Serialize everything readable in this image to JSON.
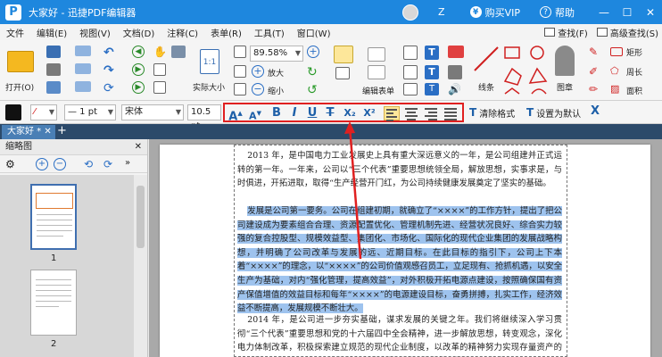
{
  "titlebar": {
    "logo": "P",
    "title": "大家好 - 迅捷PDF编辑器",
    "username": "Z",
    "buy_vip": "购买VIP",
    "help": "帮助",
    "minimize": "—",
    "maximize": "☐",
    "close": "✕"
  },
  "menu": {
    "items": [
      "文件",
      "编辑(E)",
      "视图(V)",
      "文档(D)",
      "注释(C)",
      "表单(R)",
      "工具(T)",
      "窗口(W)"
    ],
    "find": "查找(F)",
    "advanced_find": "高级查找(S)"
  },
  "ribbon": {
    "open": "打开(O)",
    "zoom_value": "89.58%",
    "zoom_in": "放大",
    "zoom_out": "缩小",
    "actual_size": "实际大小",
    "edit_form": "编辑表单",
    "line": "线条",
    "stamp": "图章",
    "rectangle": "矩形",
    "perimeter": "周长",
    "area": "面积"
  },
  "formatbar": {
    "line_width": "— 1 pt",
    "font_name": "宋体",
    "font_size": "10.5 pt",
    "grow": "A",
    "shrink": "A",
    "bold": "B",
    "italic": "I",
    "underline": "U",
    "strike": "T",
    "subscript": "X₂",
    "superscript": "X²",
    "clear_format": "清除格式",
    "set_default": "设置为默认"
  },
  "tabs": {
    "doc_tab": "大家好 *",
    "add": "+"
  },
  "sidebar": {
    "title": "缩略图",
    "close": "✕",
    "page_numbers": [
      "1",
      "2"
    ]
  },
  "document": {
    "para1": "2013 年，是中国电力工业发展史上具有重大深远意义的一年，是公司组建并正式运转的第一年。一年来，公司以“三个代表”重要思想统领全局，解放思想，实事求是，与时俱进，开拓进取，取得“生产经营开门红，为公司持续健康发展奠定了坚实的基础。",
    "para2": "发展是公司第一要务。公司在组建初期，就确立了“××××”的工作方针，提出了把公司建设成为要素组合合理、资源配置优化、管理机制先进、经营状况良好、综合实力较强的复合控股型、规模效益型、集团化、市场化、国际化的现代企业集团的发展战略构想，并明确了公司改革与发展的远、近期目标。在此目标的指引下，公司上下本着“××××”的理念，以“××××”的公司价值观感召员工，立足现有、抢抓机遇，以安全生产为基础，对内“强化管理，提高效益”，对外积极开拓电源点建设，按照确保国有资产保值增值的效益目标和每年“××××”的电源建设目标，奋勇拼搏，扎实工作，经济效益不断提高，发展规模不断壮大。",
    "para3": "2014 年，是公司进一步夯实基础，谋求发展的关键之年。我们将继续深入学习贯彻“三个代表”重要思想和党的十六届四中全会精神，进一步解放思想，转变观念，深化电力体制改革，积极探索建立规范的现代企业制度，以改革的精神努力实现存量资产的科学管理和集约经营；以创新的机制大力推进增量资产的理性扩张，在全"
  },
  "colors": {
    "titlebar": "#1e87de",
    "highlight": "#9ec3ee",
    "callout": "#e02020",
    "tabbar": "#2c4a6a"
  },
  "icons": [
    "open-folder-icon",
    "save-icon",
    "print-icon",
    "email-icon",
    "undo-icon",
    "redo-icon",
    "hand-icon",
    "select-icon",
    "zoom-in-icon",
    "zoom-out-icon",
    "text-icon",
    "comment-icon",
    "line-icon",
    "stamp-icon",
    "rectangle-icon",
    "perimeter-icon",
    "area-icon",
    "font-grow-icon",
    "font-shrink-icon",
    "clear-format-icon",
    "set-default-icon",
    "close-icon"
  ]
}
